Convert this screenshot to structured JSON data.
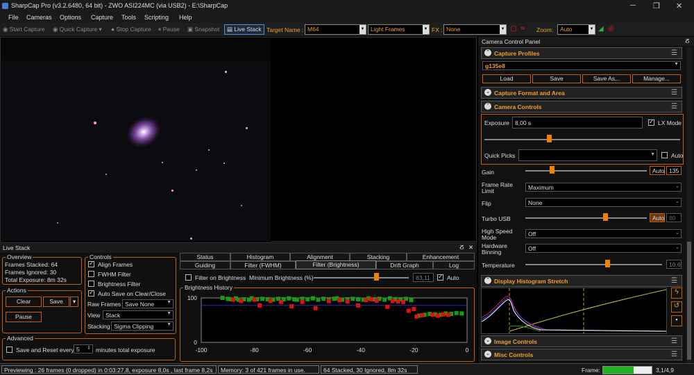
{
  "titlebar": {
    "title": "SharpCap Pro (v3.2.6480, 64 bit) - ZWO ASI224MC (via USB2) - E:\\SharpCap"
  },
  "menu": [
    "File",
    "Cameras",
    "Options",
    "Capture",
    "Tools",
    "Scripting",
    "Help"
  ],
  "toolbar": {
    "start_capture": "Start Capture",
    "quick_capture": "Quick Capture",
    "stop_capture": "Stop Capture",
    "pause": "Pause",
    "snapshot": "Snapshot",
    "live_stack": "Live Stack",
    "target_label": "Target Name :",
    "target_value": "M64",
    "frame_type": "Light Frames",
    "fx_label": "FX :",
    "fx_value": "None",
    "zoom_label": "Zoom:",
    "zoom_value": "Auto"
  },
  "livestack": {
    "title": "Live Stack",
    "overview_label": "Overview",
    "frames_stacked": "Frames Stacked: 64",
    "frames_ignored": "Frames Ignored:  30",
    "total_exposure": "Total Exposure:  8m 32s",
    "actions_label": "Actions",
    "clear": "Clear",
    "save": "Save",
    "pause": "Pause",
    "advanced_label": "Advanced",
    "save_reset": "Save and Reset every",
    "save_reset_value": "5",
    "minutes_total": "minutes total exposure",
    "controls_label": "Controls",
    "align_frames": "Align Frames",
    "fwhm_filter": "FWHM Filter",
    "brightness_filter": "Brightness Filter",
    "auto_save": "Auto Save on Clear/Close",
    "raw_frames_label": "Raw Frames",
    "raw_frames_value": "Save None",
    "view_label": "View",
    "view_value": "Stack",
    "stacking_label": "Stacking",
    "stacking_value": "Sigma Clipping",
    "tabs_row1": [
      "Status",
      "Histogram",
      "Alignment",
      "Stacking",
      "Enhancement"
    ],
    "tabs_row2": [
      "Guiding",
      "Filter (FWHM)",
      "Filter (Brightness)",
      "Drift Graph",
      "Log"
    ],
    "filter_on_brightness": "Filter on Brightness",
    "min_brightness_label": "Minimum Brightness (%)",
    "min_brightness_value": "83,11",
    "auto": "Auto",
    "brightness_history": "Brightness History"
  },
  "chart_data": {
    "type": "scatter",
    "title": "Brightness History",
    "xlabel": "",
    "ylabel": "",
    "xlim": [
      -100,
      0
    ],
    "ylim": [
      0,
      100
    ],
    "x_ticks": [
      -100,
      -80,
      -60,
      -40,
      -20,
      0
    ],
    "y_ticks": [
      100,
      0
    ],
    "threshold": 83.11,
    "series": [
      {
        "name": "",
        "color": "#1a9a1a",
        "points": [
          [
            -92,
            100
          ],
          [
            -90,
            98
          ],
          [
            -89,
            97
          ],
          [
            -87,
            99
          ],
          [
            -86,
            96
          ],
          [
            -84,
            97
          ],
          [
            -82,
            96
          ],
          [
            -81,
            99
          ],
          [
            -79,
            97
          ],
          [
            -77,
            98
          ],
          [
            -75,
            97
          ],
          [
            -73,
            96
          ],
          [
            -71,
            98
          ],
          [
            -69,
            97
          ],
          [
            -67,
            99
          ],
          [
            -65,
            97
          ],
          [
            -64,
            96
          ],
          [
            -62,
            98
          ],
          [
            -60,
            97
          ],
          [
            -58,
            99
          ],
          [
            -56,
            96
          ],
          [
            -54,
            98
          ],
          [
            -52,
            97
          ],
          [
            -50,
            98
          ],
          [
            -49,
            99
          ],
          [
            -47,
            96
          ],
          [
            -45,
            97
          ],
          [
            -43,
            98
          ],
          [
            -41,
            97
          ],
          [
            -39,
            96
          ],
          [
            -37,
            99
          ],
          [
            -35,
            97
          ],
          [
            -33,
            98
          ],
          [
            -31,
            96
          ],
          [
            -29,
            99
          ],
          [
            -27,
            97
          ],
          [
            -25,
            97
          ],
          [
            -23,
            98
          ],
          [
            -21,
            95
          ],
          [
            -18,
            60
          ],
          [
            -16,
            62
          ],
          [
            -14,
            64
          ],
          [
            -12,
            63
          ],
          [
            -10,
            62
          ],
          [
            -8,
            65
          ],
          [
            -6,
            64
          ],
          [
            -4,
            66
          ],
          [
            -2,
            65
          ]
        ]
      },
      {
        "name": "",
        "color": "#e01010",
        "points": [
          [
            -88,
            96
          ],
          [
            -85,
            93
          ],
          [
            -80,
            96
          ],
          [
            -78,
            83
          ],
          [
            -74,
            93
          ],
          [
            -70,
            91
          ],
          [
            -66,
            81
          ],
          [
            -62,
            91
          ],
          [
            -57,
            77
          ],
          [
            -52,
            93
          ],
          [
            -48,
            95
          ],
          [
            -45,
            92
          ],
          [
            -41,
            83
          ],
          [
            -38,
            95
          ],
          [
            -36,
            97
          ],
          [
            -34,
            94
          ],
          [
            -30,
            80
          ],
          [
            -28,
            93
          ],
          [
            -26,
            92
          ],
          [
            -24,
            91
          ],
          [
            -22,
            71
          ],
          [
            -20,
            75
          ],
          [
            -19,
            58
          ],
          [
            -17,
            61
          ],
          [
            -13,
            62
          ],
          [
            -11,
            60
          ],
          [
            -9,
            63
          ],
          [
            -7,
            62
          ]
        ]
      }
    ]
  },
  "camera": {
    "panel_title": "Camera Control Panel",
    "capture_profiles": "Capture Profiles",
    "profile_value": "g135e8",
    "load": "Load",
    "save": "Save",
    "save_as": "Save As...",
    "manage": "Manage...",
    "capture_format": "Capture Format and Area",
    "camera_controls": "Camera Controls",
    "exposure_label": "Exposure",
    "exposure_value": "8,00 s",
    "lx_mode": "LX Mode",
    "quick_picks": "Quick Picks",
    "auto": "Auto",
    "gain_label": "Gain",
    "gain_value": "135",
    "frame_rate_label": "Frame Rate Limit",
    "frame_rate_value": "Maximum",
    "flip_label": "Flip",
    "flip_value": "None",
    "turbo_label": "Turbo USB",
    "turbo_value": "80",
    "hs_label": "High Speed Mode",
    "hs_value": "Off",
    "hw_label": "Hardware Binning",
    "hw_value": "Off",
    "temp_label": "Temperature",
    "temp_value": "10,6",
    "histogram_stretch": "Display Histogram Stretch",
    "image_controls": "Image Controls",
    "misc_controls": "Misc Controls"
  },
  "status": {
    "preview": "Previewing : 26 frames (0 dropped) in 0:03:27,8, exposure 8,0s , last frame 8,2s",
    "memory": "Memory: 3 of 421 frames in use.",
    "stack": "64 Stacked, 30 Ignored, 8m 32s",
    "frame_label": "Frame:",
    "frame_value": "3,1/4,9",
    "frame_progress": 0.63
  }
}
